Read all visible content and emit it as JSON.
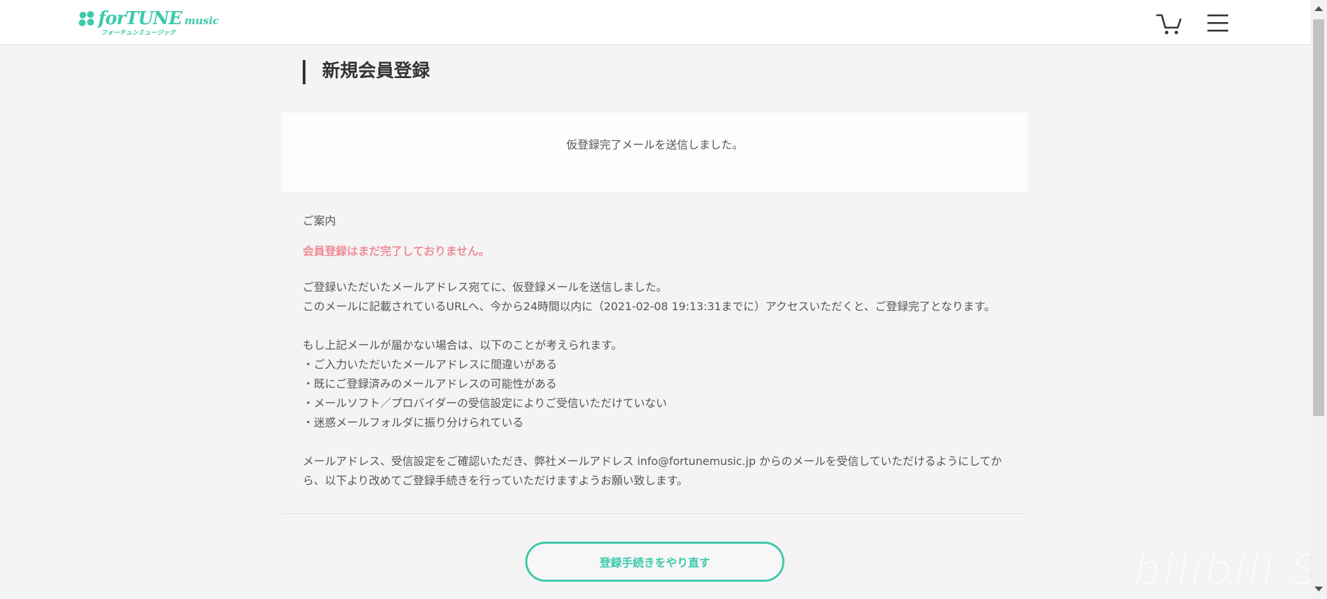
{
  "header": {
    "logo_main": "forTUNE",
    "logo_music": "music",
    "logo_sub": "フォーチュンミュージック",
    "cart_icon": "cart-icon",
    "menu_icon": "hamburger-menu-icon"
  },
  "page": {
    "title": "新規会員登録"
  },
  "notice": {
    "text": "仮登録完了メールを送信しました。"
  },
  "guide": {
    "heading": "ご案内",
    "warning": "会員登録はまだ完了しておりません。",
    "para1": [
      "ご登録いただいたメールアドレス宛てに、仮登録メールを送信しました。",
      "このメールに記載されているURLへ、今から24時間以内に（2021-02-08 19:13:31までに）アクセスいただくと、ご登録完了となります。"
    ],
    "para2": [
      "もし上記メールが届かない場合は、以下のことが考えられます。",
      "・ご入力いただいたメールアドレスに間違いがある",
      "・既にご登録済みのメールアドレスの可能性がある",
      "・メールソフト／プロバイダーの受信設定によりご受信いただけていない",
      "・迷惑メールフォルダに振り分けられている"
    ],
    "para3": [
      "メールアドレス、受信設定をご確認いただき、弊社メールアドレス info@fortunemusic.jp からのメールを受信していただけるようにしてか",
      "ら、以下より改めてご登録手続きを行っていただけますようお願い致します。"
    ]
  },
  "actions": {
    "retry_label": "登録手続きをやり直す"
  },
  "watermark": "bilibili SOV",
  "colors": {
    "accent": "#3ec9ac",
    "warning": "#f08c97",
    "background": "#f4f4f4"
  }
}
